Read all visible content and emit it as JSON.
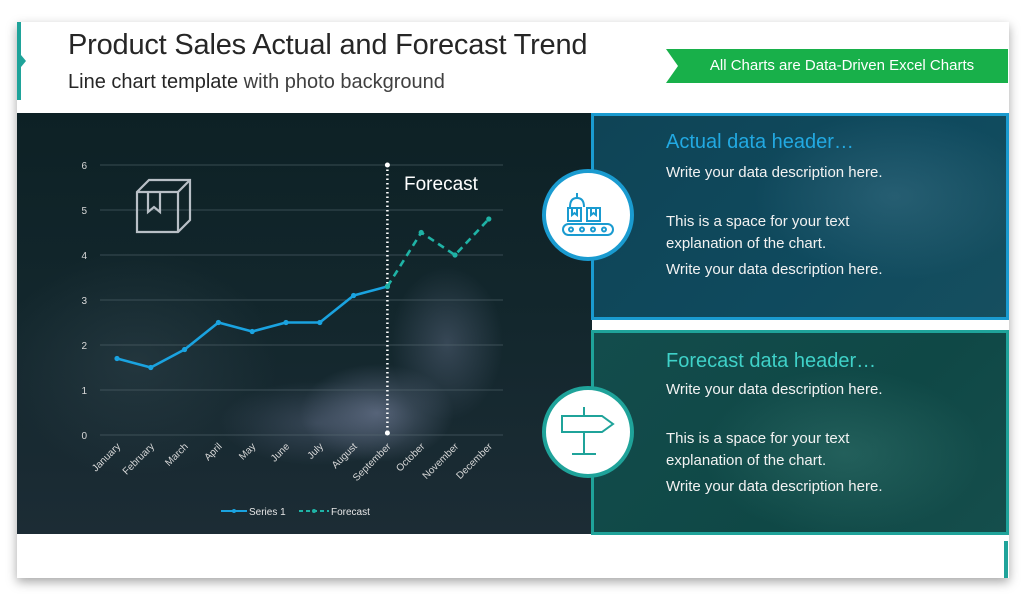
{
  "header": {
    "title": "Product Sales Actual and Forecast Trend",
    "subtitle_bold": "Line chart template",
    "subtitle_rest": " with photo background",
    "banner": "All Charts are Data-Driven Excel Charts"
  },
  "colors": {
    "actual": "#1aa3e0",
    "forecast": "#1fb3a6",
    "banner": "#18b04a",
    "accent": "#1fa39a"
  },
  "chart_data": {
    "type": "line",
    "title": "",
    "annotation": "Forecast",
    "xlabel": "",
    "ylabel": "",
    "ylim": [
      0,
      6
    ],
    "yticks": [
      0,
      1,
      2,
      3,
      4,
      5,
      6
    ],
    "grid": true,
    "legend_position": "bottom",
    "categories": [
      "January",
      "February",
      "March",
      "April",
      "May",
      "June",
      "July",
      "August",
      "September",
      "October",
      "November",
      "December"
    ],
    "series": [
      {
        "name": "Series 1",
        "style": "solid",
        "values": [
          1.7,
          1.5,
          1.9,
          2.5,
          2.3,
          2.5,
          2.5,
          3.1,
          3.3,
          null,
          null,
          null
        ]
      },
      {
        "name": "Forecast",
        "style": "dashed",
        "values": [
          null,
          null,
          null,
          null,
          null,
          null,
          null,
          null,
          3.3,
          4.5,
          4.0,
          4.8
        ]
      }
    ],
    "divider_at": "September"
  },
  "panels": [
    {
      "header": "Actual data header…",
      "icon": "conveyor-belt-boxes-icon",
      "lines": [
        "Write your data description here.",
        "This is a space for your text explanation of the chart.",
        "Write your data description here."
      ]
    },
    {
      "header": "Forecast data header…",
      "icon": "signpost-icon",
      "lines": [
        "Write your data description here.",
        "This is a space for your text explanation of the chart.",
        "Write your data description here."
      ]
    }
  ]
}
